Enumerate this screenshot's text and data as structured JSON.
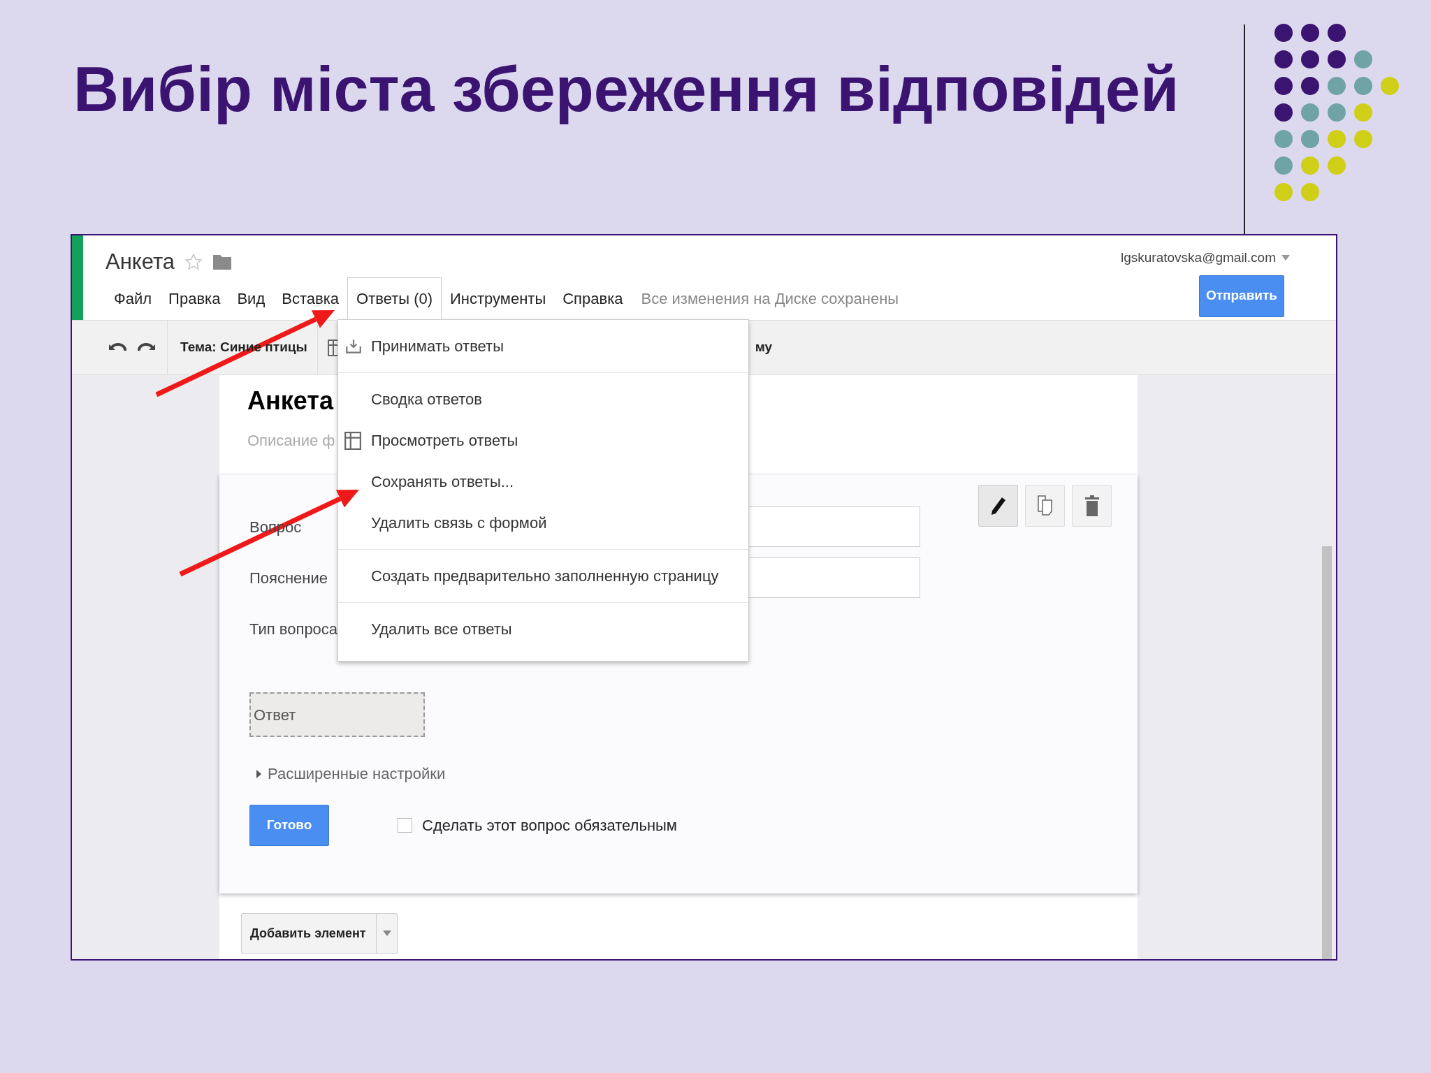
{
  "slide_title": "Вибір міста збереження відповідей",
  "app": {
    "doc_title": "Анкета",
    "starred": false,
    "menu": [
      {
        "label": "Файл",
        "selected": false
      },
      {
        "label": "Правка",
        "selected": false
      },
      {
        "label": "Вид",
        "selected": false
      },
      {
        "label": "Вставка",
        "selected": false
      },
      {
        "label": "Ответы (0)",
        "selected": true
      },
      {
        "label": "Инструменты",
        "selected": false
      },
      {
        "label": "Справка",
        "selected": false
      }
    ],
    "save_status": "Все изменения на Диске сохранены",
    "account": "lgskuratovska@gmail.com",
    "send_button": "Отправить",
    "toolbar": {
      "theme": "Тема: Синие птицы",
      "trailing_text": "му"
    },
    "form": {
      "title": "Анкета",
      "description_placeholder": "Описание ф",
      "question": {
        "labels": [
          "Вопрос",
          "Пояснение",
          "Тип вопроса"
        ],
        "answer_placeholder": "Ответ",
        "advanced": "Расширенные настройки",
        "advanced_expanded": false,
        "done_button": "Готово",
        "required_label": "Сделать этот вопрос обязательным",
        "required": false
      },
      "add_item_button": "Добавить элемент"
    },
    "dropdown": {
      "sections": [
        [
          {
            "label": "Принимать ответы",
            "kind": "toggle"
          }
        ],
        [
          {
            "label": "Сводка ответов",
            "kind": "plain"
          },
          {
            "label": "Просмотреть ответы",
            "kind": "sheet"
          },
          {
            "label": "Сохранять ответы...",
            "kind": "plain"
          },
          {
            "label": "Удалить связь с формой",
            "kind": "plain"
          }
        ],
        [
          {
            "label": "Создать предварительно заполненную страницу",
            "kind": "plain"
          }
        ],
        [
          {
            "label": "Удалить все ответы",
            "kind": "plain"
          }
        ]
      ]
    }
  }
}
